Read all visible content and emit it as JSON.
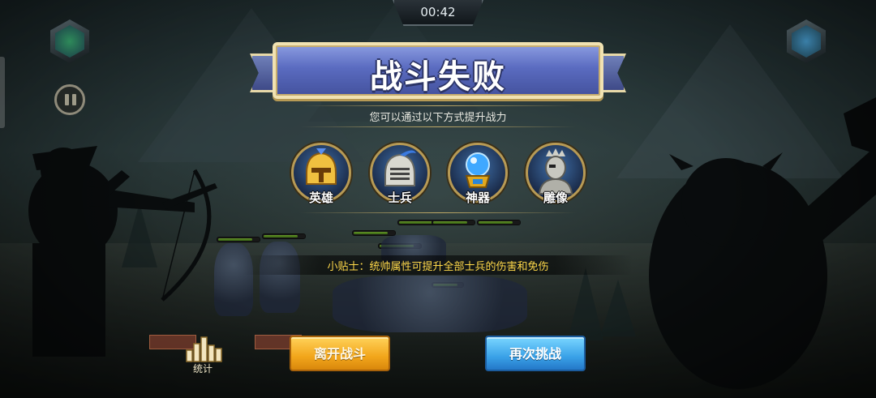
{
  "hud": {
    "timer": "00:42"
  },
  "result": {
    "title": "战斗失败",
    "subtitle": "您可以通过以下方式提升战力"
  },
  "options": [
    {
      "label": "英雄",
      "icon": "golden-helmet-icon"
    },
    {
      "label": "士兵",
      "icon": "knight-helmet-icon"
    },
    {
      "label": "神器",
      "icon": "crystal-orb-icon"
    },
    {
      "label": "雕像",
      "icon": "statue-bust-icon"
    }
  ],
  "tip": {
    "text": "小贴士：统帅属性可提升全部士兵的伤害和免伤"
  },
  "buttons": {
    "stats_label": "统计",
    "leave_label": "离开战斗",
    "retry_label": "再次挑战"
  },
  "colors": {
    "banner_blue": "#5a6bc0",
    "gold_trim": "#f1e2b2",
    "tip_yellow": "#ffd94a",
    "leave_orange": "#f2a61b",
    "retry_blue": "#3aa2e8"
  }
}
